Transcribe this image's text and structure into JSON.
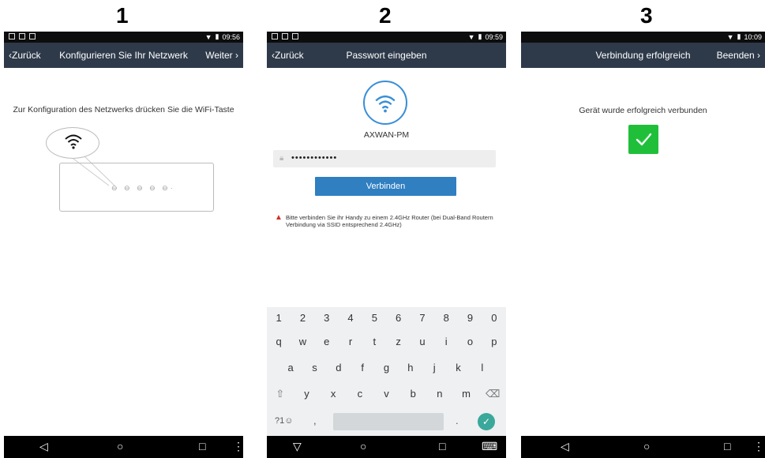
{
  "steps": [
    "1",
    "2",
    "3"
  ],
  "nav_icons": [
    "back-triangle-icon",
    "home-circle-icon",
    "recent-square-icon",
    "menu-dots-icon"
  ],
  "phone1": {
    "time": "09:56",
    "back_label": "Zurück",
    "title": "Konfigurieren Sie Ihr Netzwerk",
    "next_label": "Weiter",
    "instruction": "Zur Konfiguration des Netzwerks drücken Sie die WiFi-Taste"
  },
  "phone2": {
    "time": "09:59",
    "back_label": "Zurück",
    "title": "Passwort eingeben",
    "ssid": "AXWAN-PM",
    "password_value": "••••••••••••",
    "connect_label": "Verbinden",
    "warning": "Bitte verbinden Sie ihr Handy zu einem 2.4GHz Router (bei Dual-Band Routern Verbindung via SSID entsprechend 2.4GHz)",
    "keyboard": {
      "numbers": [
        "1",
        "2",
        "3",
        "4",
        "5",
        "6",
        "7",
        "8",
        "9",
        "0"
      ],
      "row1": [
        "q",
        "w",
        "e",
        "r",
        "t",
        "z",
        "u",
        "i",
        "o",
        "p"
      ],
      "row2": [
        "a",
        "s",
        "d",
        "f",
        "g",
        "h",
        "j",
        "k",
        "l"
      ],
      "row3": [
        "y",
        "x",
        "c",
        "v",
        "b",
        "n",
        "m"
      ],
      "symbols_label": "?1☺",
      "comma": ",",
      "period": "."
    }
  },
  "phone3": {
    "time": "10:09",
    "title": "Verbindung erfolgreich",
    "finish_label": "Beenden",
    "success": "Gerät wurde erfolgreich verbunden"
  },
  "colors": {
    "app_bar": "#2e3a4a",
    "accent_blue": "#2f7fc1",
    "success_green": "#1fbf3a",
    "warning_red": "#d0302a"
  }
}
